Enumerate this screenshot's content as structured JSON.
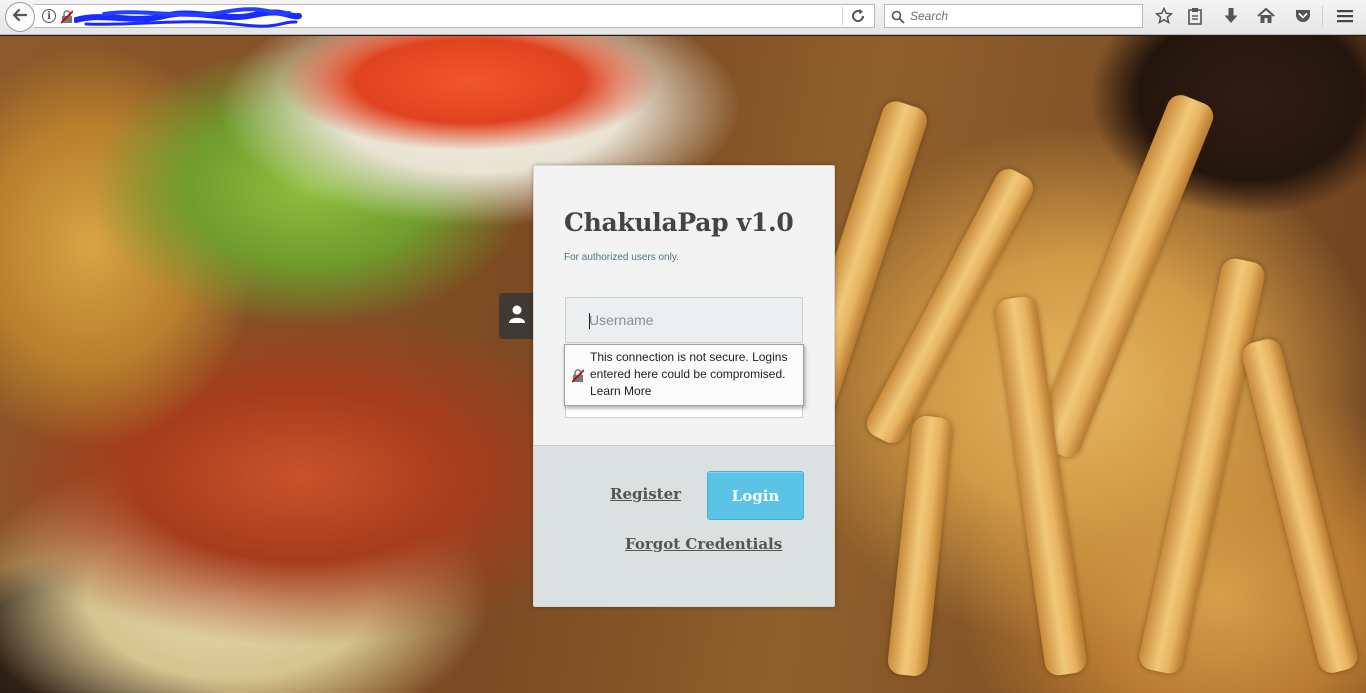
{
  "browser": {
    "search": {
      "placeholder": "Search"
    },
    "icons": {
      "back": "back-arrow-icon",
      "info": "info-icon",
      "insecure": "insecure-lock-icon",
      "reload": "reload-icon",
      "search": "search-icon",
      "bookmark": "bookmark-star-icon",
      "reading_list": "clipboard-icon",
      "downloads": "download-icon",
      "home": "home-icon",
      "pocket": "pocket-icon",
      "menu": "hamburger-menu-icon"
    }
  },
  "login": {
    "title": "ChakulaPap v1.0",
    "subtitle": "For authorized users only.",
    "username_placeholder": "Username",
    "register_label": "Register",
    "login_label": "Login",
    "forgot_label": "Forgot Credentials",
    "user_icon": "user-icon"
  },
  "warning": {
    "line1": "This connection is not secure. Logins",
    "line2": "entered here could be compromised.",
    "link": "Learn More"
  },
  "colors": {
    "accent": "#5bc4e6",
    "card_top": "#f3f3f3",
    "card_bottom": "#dbe1e1"
  }
}
